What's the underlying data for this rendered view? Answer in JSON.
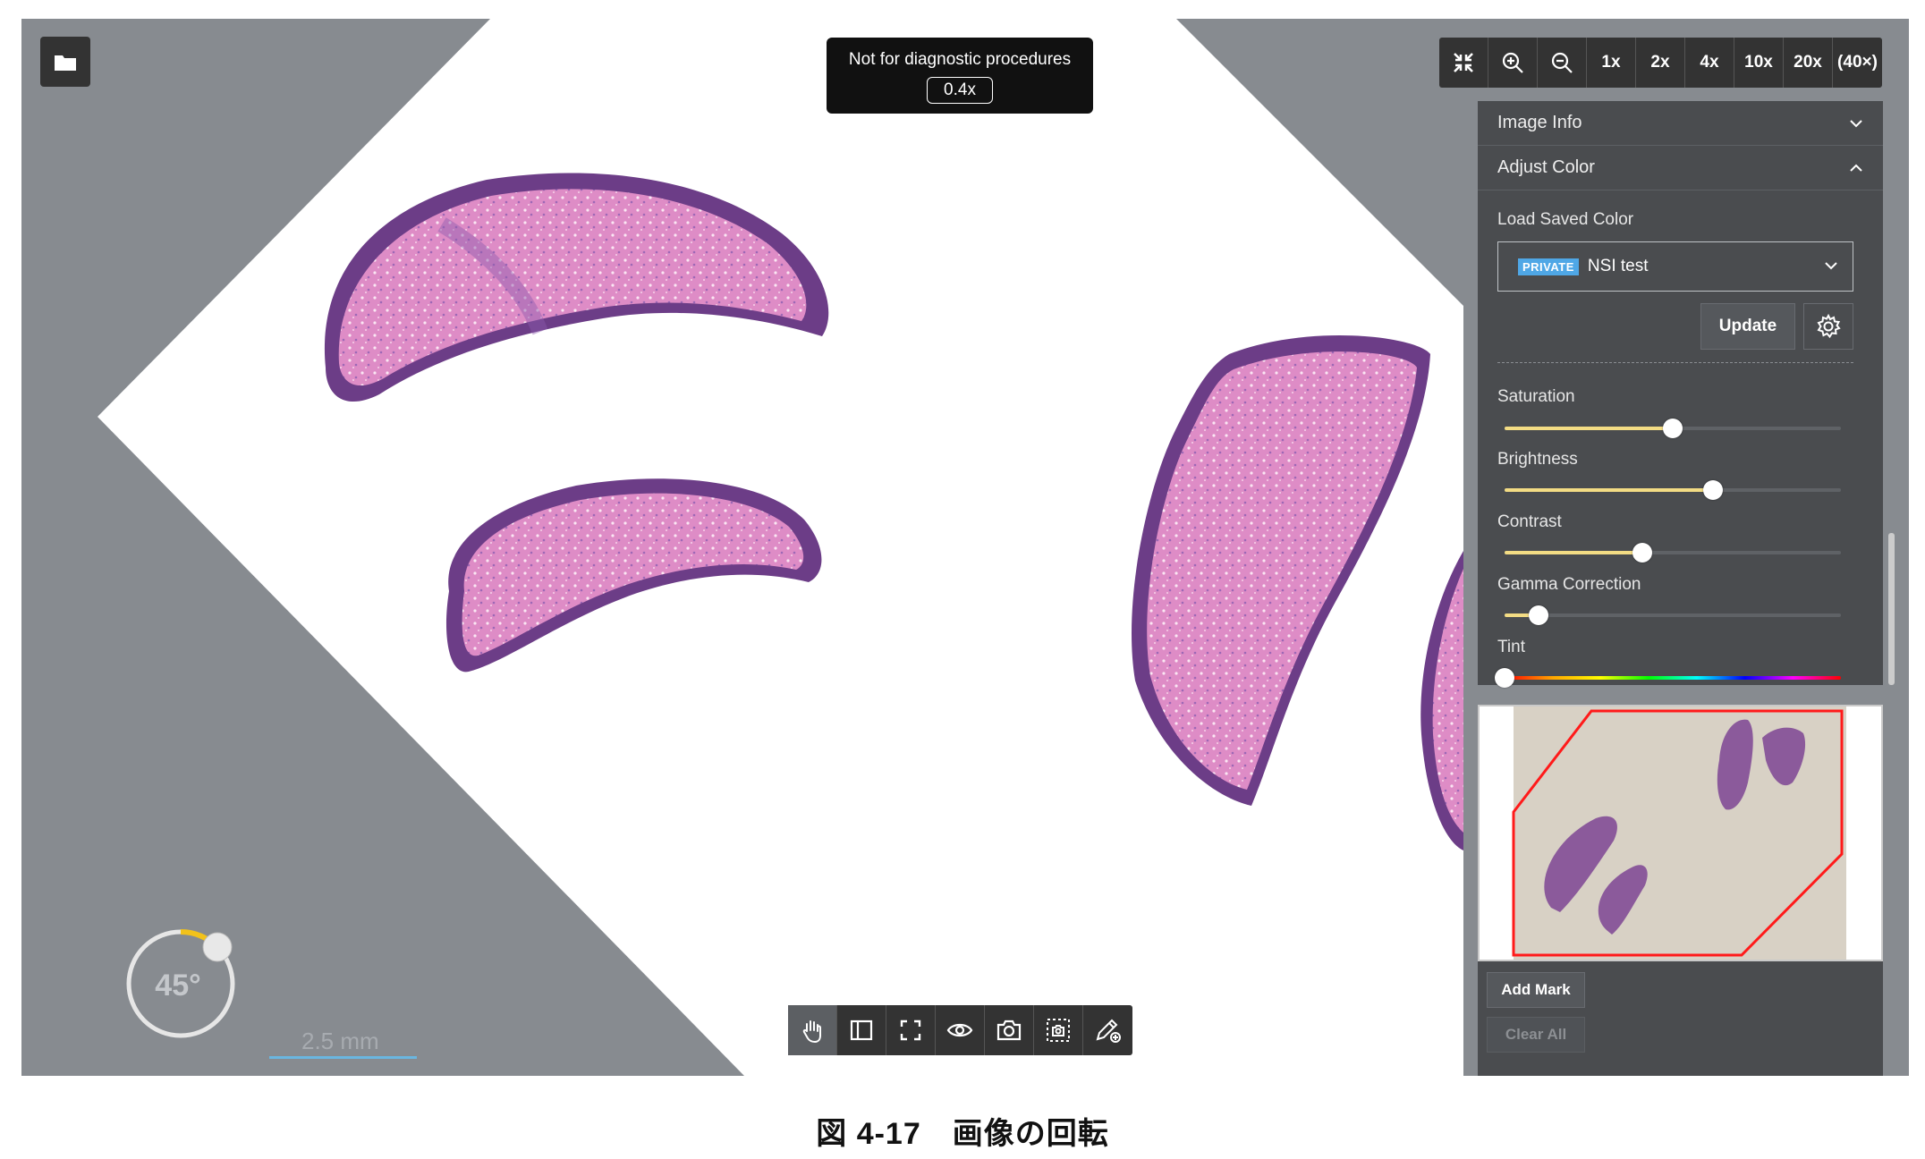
{
  "warning": {
    "text": "Not for diagnostic procedures",
    "magnification": "0.4x"
  },
  "zoom_toolbar": {
    "icons": [
      "fit-screen-icon",
      "zoom-in-icon",
      "zoom-out-icon"
    ],
    "levels": [
      "1x",
      "2x",
      "4x",
      "10x",
      "20x",
      "(40×)"
    ]
  },
  "panel": {
    "image_info": "Image Info",
    "adjust_color": "Adjust Color",
    "load_saved_color": "Load Saved Color",
    "saved_color": {
      "badge": "PRIVATE",
      "name": "NSI test"
    },
    "update_label": "Update",
    "sliders": [
      {
        "key": "saturation",
        "label": "Saturation",
        "value": 0.5
      },
      {
        "key": "brightness",
        "label": "Brightness",
        "value": 0.62
      },
      {
        "key": "contrast",
        "label": "Contrast",
        "value": 0.41
      },
      {
        "key": "gamma",
        "label": "Gamma Correction",
        "value": 0.1
      },
      {
        "key": "tint",
        "label": "Tint",
        "value": 0.0
      }
    ],
    "badge_color": "#4fa7e6",
    "slider_fill_color": "#f3dc84"
  },
  "marks": {
    "add_mark": "Add Mark",
    "clear_all": "Clear All"
  },
  "rotation": {
    "angle": "45°",
    "arc_color": "#f2c21b"
  },
  "scale_bar": "2.5 mm",
  "bottom_toolbar": {
    "tools": [
      "pan-hand-icon",
      "sidebar-panel-icon",
      "fullscreen-icon",
      "eye-icon",
      "camera-icon",
      "region-capture-icon",
      "annotate-pen-icon"
    ],
    "active": "pan-hand-icon"
  },
  "caption": "図 4-17　画像の回転"
}
